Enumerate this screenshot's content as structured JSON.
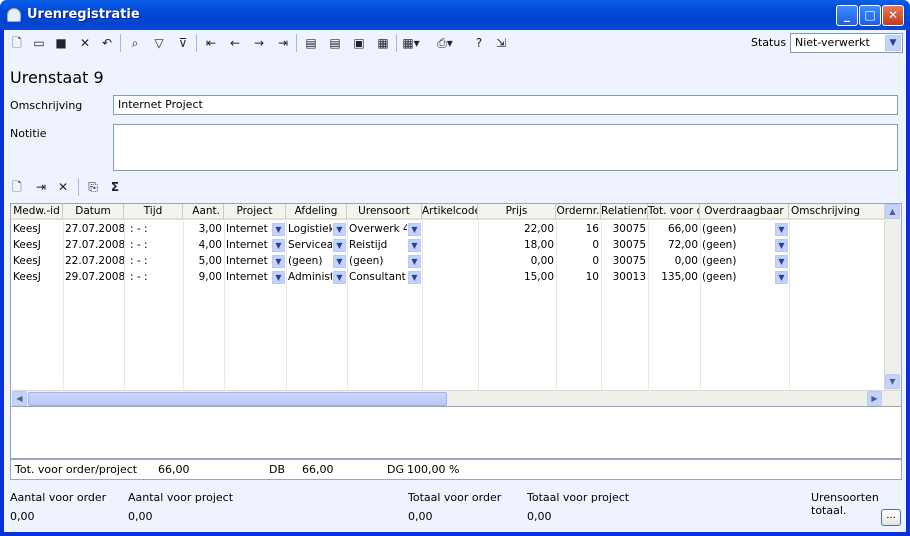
{
  "window": {
    "title": "Urenregistratie"
  },
  "toolbar": {
    "status_label": "Status",
    "status_value": "Niet-verwerkt",
    "icons": [
      "new-icon",
      "open-icon",
      "save-icon",
      "delete-icon",
      "undo-icon",
      "find-icon",
      "filter-icon",
      "filter-clear-icon",
      "first-record-icon",
      "prev-record-icon",
      "next-record-icon",
      "last-record-icon",
      "doc-icon-1",
      "doc-icon-2",
      "doc-icon-3",
      "doc-icon-4",
      "properties-icon",
      "print-icon",
      "help-icon",
      "exit-icon"
    ]
  },
  "form": {
    "page_title": "Urenstaat 9",
    "omschrijving_label": "Omschrijving",
    "omschrijving_value": "Internet Project",
    "notitie_label": "Notitie",
    "notitie_value": ""
  },
  "grid": {
    "columns": [
      "Medw.-id",
      "Datum",
      "Tijd",
      "Aant.",
      "Project",
      "Afdeling",
      "Urensoort",
      "Artikelcode",
      "Prijs",
      "Ordernr.",
      "Relatienr.",
      "Tot. voor o",
      "Overdraagbaar",
      "Omschrijving"
    ],
    "rows": [
      {
        "medw": "KeesJ",
        "datum": "27.07.2008",
        "tijd": ": - :",
        "aant": "3,00",
        "project": "Internet",
        "afdeling": "Logistiek",
        "urensoort": "Overwerk 4",
        "artikel": "",
        "prijs": "22,00",
        "order": "16",
        "relatie": "30075",
        "tot": "66,00",
        "overdraag": "(geen)",
        "omschr": ""
      },
      {
        "medw": "KeesJ",
        "datum": "27.07.2008",
        "tijd": ": - :",
        "aant": "4,00",
        "project": "Internet",
        "afdeling": "Serviceafd",
        "urensoort": "Reistijd",
        "artikel": "",
        "prijs": "18,00",
        "order": "0",
        "relatie": "30075",
        "tot": "72,00",
        "overdraag": "(geen)",
        "omschr": ""
      },
      {
        "medw": "KeesJ",
        "datum": "22.07.2008",
        "tijd": ": - :",
        "aant": "5,00",
        "project": "Internet",
        "afdeling": "(geen)",
        "urensoort": "(geen)",
        "artikel": "",
        "prijs": "0,00",
        "order": "0",
        "relatie": "30075",
        "tot": "0,00",
        "overdraag": "(geen)",
        "omschr": ""
      },
      {
        "medw": "KeesJ",
        "datum": "29.07.2008",
        "tijd": ": - :",
        "aant": "9,00",
        "project": "Internet",
        "afdeling": "Administ",
        "urensoort": "Consultant",
        "artikel": "",
        "prijs": "15,00",
        "order": "10",
        "relatie": "30013",
        "tot": "135,00",
        "overdraag": "(geen)",
        "omschr": ""
      }
    ]
  },
  "totals": {
    "label": "Tot. voor order/project",
    "value": "66,00",
    "db_label": "DB",
    "db_value": "66,00",
    "dg_label": "DG",
    "dg_value": "100,00 %"
  },
  "footer": {
    "aantal_order_label": "Aantal voor order",
    "aantal_order_value": "0,00",
    "aantal_project_label": "Aantal voor project",
    "aantal_project_value": "0,00",
    "totaal_order_label": "Totaal voor order",
    "totaal_order_value": "0,00",
    "totaal_project_label": "Totaal voor project",
    "totaal_project_value": "0,00",
    "urensoorten_label": "Urensoorten totaal.",
    "dots_button": "..."
  },
  "colors": {
    "titlebar": "#0048d8",
    "client": "#eef3fd",
    "accent": "#2a3f8d"
  }
}
